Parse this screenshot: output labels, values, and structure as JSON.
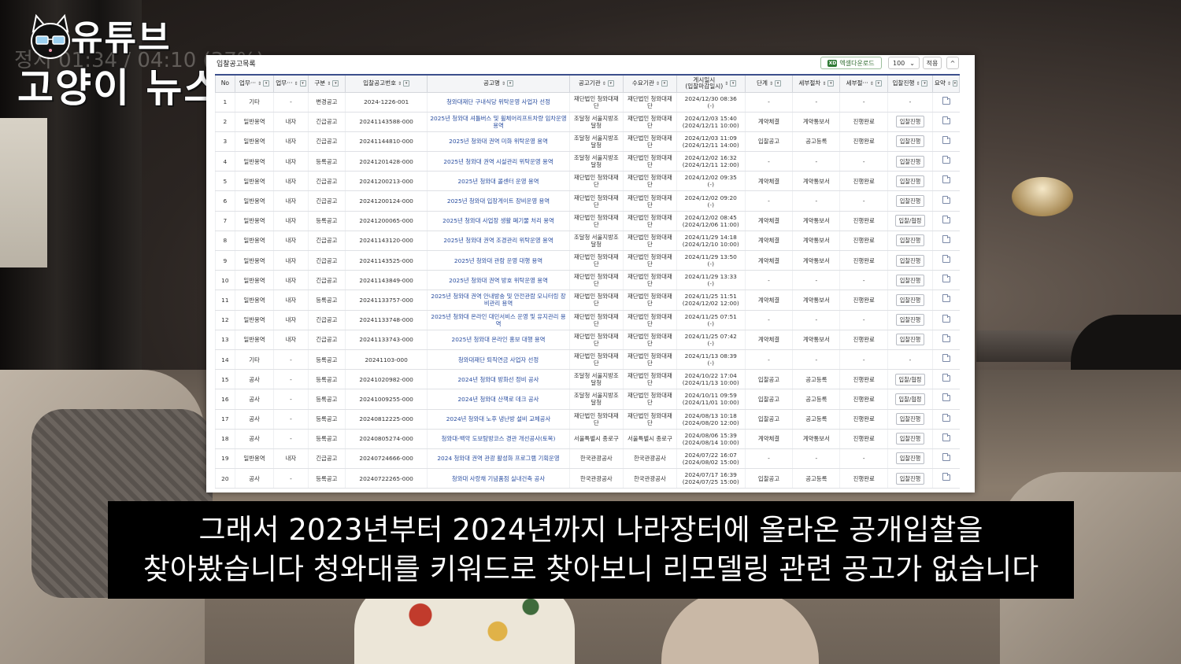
{
  "logo": {
    "line1": "유튜브",
    "line2": "고양이 뉴스",
    "ghost_text": "정지 01:34 / 04:10 (37%)"
  },
  "window": {
    "title": "입찰공고목록",
    "excel_button": "엑셀다운로드",
    "page_size": "100",
    "apply_button": "적용",
    "collapse_icon": "^"
  },
  "table": {
    "columns": [
      "No",
      "업무···",
      "업무···",
      "구분",
      "입찰공고번호",
      "공고명",
      "공고기관",
      "수요기관",
      "게시일시\n(입찰마감일시)",
      "단계",
      "세부절차",
      "세부절···",
      "입찰진행",
      "요약"
    ],
    "rows": [
      {
        "no": "1",
        "type": "기타",
        "sub": "-",
        "kind": "변경공고",
        "num": "2024-1226-001",
        "title": "청와대재단 구내식당 위탁운영 사업자 선정",
        "agency": "재단법인 청와대재단",
        "demand": "재단법인 청와대재단",
        "date": "2024/12/30 08:36",
        "close": "(-)",
        "stage": "-",
        "detail": "-",
        "detail2": "-",
        "proc": "-"
      },
      {
        "no": "2",
        "type": "일반용역",
        "sub": "내자",
        "kind": "긴급공고",
        "num": "20241143588-000",
        "title": "2025년 청와대 셔틀버스 및 휠체어리프트차량 임차운영 용역",
        "agency": "조달청 서울지방조달청",
        "demand": "재단법인 청와대재단",
        "date": "2024/12/03 15:40",
        "close": "(2024/12/11 10:00)",
        "stage": "계약체결",
        "detail": "계약통보서",
        "detail2": "진행완료",
        "proc": "입찰진행"
      },
      {
        "no": "3",
        "type": "일반용역",
        "sub": "내자",
        "kind": "긴급공고",
        "num": "20241144810-000",
        "title": "2025년 청와대 권역 미화 위탁운영 용역",
        "agency": "조달청 서울지방조달청",
        "demand": "재단법인 청와대재단",
        "date": "2024/12/03 11:09",
        "close": "(2024/12/11 14:00)",
        "stage": "입찰공고",
        "detail": "공고등록",
        "detail2": "진행완료",
        "proc": "입찰진행"
      },
      {
        "no": "4",
        "type": "일반용역",
        "sub": "내자",
        "kind": "등록공고",
        "num": "20241201428-000",
        "title": "2025년 청와대 권역 시설관리 위탁운영 용역",
        "agency": "조달청 서울지방조달청",
        "demand": "재단법인 청와대재단",
        "date": "2024/12/02 16:32",
        "close": "(2024/12/11 12:00)",
        "stage": "-",
        "detail": "-",
        "detail2": "-",
        "proc": "입찰진행"
      },
      {
        "no": "5",
        "type": "일반용역",
        "sub": "내자",
        "kind": "긴급공고",
        "num": "20241200213-000",
        "title": "2025년 청와대 콜센터 운영 용역",
        "agency": "재단법인 청와대재단",
        "demand": "재단법인 청와대재단",
        "date": "2024/12/02 09:35",
        "close": "(-)",
        "stage": "계약체결",
        "detail": "계약통보서",
        "detail2": "진행완료",
        "proc": "입찰진행"
      },
      {
        "no": "6",
        "type": "일반용역",
        "sub": "내자",
        "kind": "긴급공고",
        "num": "20241200124-000",
        "title": "2025년 청와대 입장게이트 장비운영 용역",
        "agency": "재단법인 청와대재단",
        "demand": "재단법인 청와대재단",
        "date": "2024/12/02 09:20",
        "close": "(-)",
        "stage": "-",
        "detail": "-",
        "detail2": "-",
        "proc": "입찰진행"
      },
      {
        "no": "7",
        "type": "일반용역",
        "sub": "내자",
        "kind": "등록공고",
        "num": "20241200065-000",
        "title": "2025년 청와대 사업장 생활 폐기물 처리 용역",
        "agency": "재단법인 청와대재단",
        "demand": "재단법인 청와대재단",
        "date": "2024/12/02 08:45",
        "close": "(2024/12/06 11:00)",
        "stage": "계약체결",
        "detail": "계약통보서",
        "detail2": "진행완료",
        "proc": "입찰/협정"
      },
      {
        "no": "8",
        "type": "일반용역",
        "sub": "내자",
        "kind": "긴급공고",
        "num": "20241143120-000",
        "title": "2025년 청와대 권역 조경관리 위탁운영 용역",
        "agency": "조달청 서울지방조달청",
        "demand": "재단법인 청와대재단",
        "date": "2024/11/29 14:18",
        "close": "(2024/12/10 10:00)",
        "stage": "계약체결",
        "detail": "계약통보서",
        "detail2": "진행완료",
        "proc": "입찰진행"
      },
      {
        "no": "9",
        "type": "일반용역",
        "sub": "내자",
        "kind": "긴급공고",
        "num": "20241143525-000",
        "title": "2025년 청와대 관람 운영 대행 용역",
        "agency": "재단법인 청와대재단",
        "demand": "재단법인 청와대재단",
        "date": "2024/11/29 13:50",
        "close": "(-)",
        "stage": "계약체결",
        "detail": "계약통보서",
        "detail2": "진행완료",
        "proc": "입찰진행"
      },
      {
        "no": "10",
        "type": "일반용역",
        "sub": "내자",
        "kind": "긴급공고",
        "num": "20241143849-000",
        "title": "2025년 청와대 권역 방호 위탁운영 용역",
        "agency": "재단법인 청와대재단",
        "demand": "재단법인 청와대재단",
        "date": "2024/11/29 13:33",
        "close": "(-)",
        "stage": "-",
        "detail": "-",
        "detail2": "-",
        "proc": "입찰진행"
      },
      {
        "no": "11",
        "type": "일반용역",
        "sub": "내자",
        "kind": "등록공고",
        "num": "20241133757-000",
        "title": "2025년 청와대 권역 안내방송 및 안전관람 모니터링 장비관리 용역",
        "agency": "재단법인 청와대재단",
        "demand": "재단법인 청와대재단",
        "date": "2024/11/25 11:51",
        "close": "(2024/12/02 12:00)",
        "stage": "계약체결",
        "detail": "계약통보서",
        "detail2": "진행완료",
        "proc": "입찰진행"
      },
      {
        "no": "12",
        "type": "일반용역",
        "sub": "내자",
        "kind": "긴급공고",
        "num": "20241133748-000",
        "title": "2025년 청와대 온라인 대민서비스 운영 및 유지관리 용역",
        "agency": "재단법인 청와대재단",
        "demand": "재단법인 청와대재단",
        "date": "2024/11/25 07:51",
        "close": "(-)",
        "stage": "-",
        "detail": "-",
        "detail2": "-",
        "proc": "입찰진행"
      },
      {
        "no": "13",
        "type": "일반용역",
        "sub": "내자",
        "kind": "긴급공고",
        "num": "20241133743-000",
        "title": "2025년 청와대 온라인 홍보 대행 용역",
        "agency": "재단법인 청와대재단",
        "demand": "재단법인 청와대재단",
        "date": "2024/11/25 07:42",
        "close": "(-)",
        "stage": "계약체결",
        "detail": "계약통보서",
        "detail2": "진행완료",
        "proc": "입찰진행"
      },
      {
        "no": "14",
        "type": "기타",
        "sub": "-",
        "kind": "등록공고",
        "num": "20241103-000",
        "title": "청와대재단 퇴직연금 사업자 선정",
        "agency": "재단법인 청와대재단",
        "demand": "재단법인 청와대재단",
        "date": "2024/11/13 08:39",
        "close": "(-)",
        "stage": "-",
        "detail": "-",
        "detail2": "-",
        "proc": "-"
      },
      {
        "no": "15",
        "type": "공사",
        "sub": "-",
        "kind": "등록공고",
        "num": "20241020982-000",
        "title": "2024년 청와대 방화선 정비 공사",
        "agency": "조달청 서울지방조달청",
        "demand": "재단법인 청와대재단",
        "date": "2024/10/22 17:04",
        "close": "(2024/11/13 10:00)",
        "stage": "입찰공고",
        "detail": "공고등록",
        "detail2": "진행완료",
        "proc": "입찰/협정"
      },
      {
        "no": "16",
        "type": "공사",
        "sub": "-",
        "kind": "등록공고",
        "num": "20241009255-000",
        "title": "2024년 청와대 산책로 데크 공사",
        "agency": "조달청 서울지방조달청",
        "demand": "재단법인 청와대재단",
        "date": "2024/10/11 09:59",
        "close": "(2024/11/01 10:00)",
        "stage": "입찰공고",
        "detail": "공고등록",
        "detail2": "진행완료",
        "proc": "입찰/협정"
      },
      {
        "no": "17",
        "type": "공사",
        "sub": "-",
        "kind": "등록공고",
        "num": "20240812225-000",
        "title": "2024년 청와대 노후 냉난방 설비 교체공사",
        "agency": "재단법인 청와대재단",
        "demand": "재단법인 청와대재단",
        "date": "2024/08/13 10:18",
        "close": "(2024/08/20 12:00)",
        "stage": "입찰공고",
        "detail": "공고등록",
        "detail2": "진행완료",
        "proc": "입찰진행"
      },
      {
        "no": "18",
        "type": "공사",
        "sub": "-",
        "kind": "등록공고",
        "num": "20240805274-000",
        "title": "청와대-백악 도보탐방코스 경관 개선공사(토목)",
        "agency": "서울특별시 종로구",
        "demand": "서울특별시 종로구",
        "date": "2024/08/06 15:39",
        "close": "(2024/08/14 10:00)",
        "stage": "계약체결",
        "detail": "계약통보서",
        "detail2": "진행완료",
        "proc": "입찰진행"
      },
      {
        "no": "19",
        "type": "일반용역",
        "sub": "내자",
        "kind": "긴급공고",
        "num": "20240724666-000",
        "title": "2024 청와대 권역 관광 활성화 프로그램 기획운영",
        "agency": "한국관광공사",
        "demand": "한국관광공사",
        "date": "2024/07/22 16:07",
        "close": "(2024/08/02 15:00)",
        "stage": "-",
        "detail": "-",
        "detail2": "-",
        "proc": "입찰진행"
      },
      {
        "no": "20",
        "type": "공사",
        "sub": "-",
        "kind": "등록공고",
        "num": "20240722265-000",
        "title": "청와대 사랑채 기념품점 실내건축 공사",
        "agency": "한국관광공사",
        "demand": "한국관광공사",
        "date": "2024/07/17 16:39",
        "close": "(2024/07/25 15:00)",
        "stage": "입찰공고",
        "detail": "공고등록",
        "detail2": "진행완료",
        "proc": "입찰진행"
      }
    ]
  },
  "subtitle": {
    "line1": "그래서 2023년부터 2024년까지 나라장터에 올라온 공개입찰을",
    "line2": "찾아봤습니다 청와대를 키워드로 찾아보니 리모델링 관련 공고가 없습니다"
  }
}
